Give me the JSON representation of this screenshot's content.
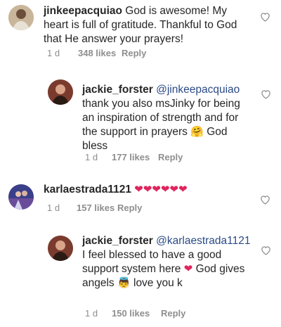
{
  "comments": [
    {
      "username": "jinkeepacquiao",
      "text": " God is awesome! My heart is full of gratitude. Thankful to God that He answer your prayers!",
      "time": "1 d",
      "likes": "348 likes",
      "reply": "Reply",
      "avatar_icon": "avatar-woman-icon"
    },
    {
      "username": "jackie_forster",
      "mention": "@jinkeepacquiao",
      "text": "thank you also msJinky for being an inspiration of strength and for the support in prayers",
      "emoji": "🤗",
      "text_end": " God bless",
      "time": "1 d",
      "likes": "177 likes",
      "reply": "Reply",
      "avatar_icon": "avatar-woman-icon"
    },
    {
      "username": "karlaestrada1121",
      "hearts": "❤❤❤❤❤❤",
      "time": "1 d",
      "likes": "157 likes",
      "reply": "Reply",
      "avatar_icon": "avatar-photo-icon"
    },
    {
      "username": "jackie_forster",
      "mention": "@karlaestrada1121",
      "text": " I feel blessed to have a good support system here",
      "heart": "❤",
      "text_end": " God gives angels",
      "emoji": "👼",
      "text_last": " love you k",
      "time": "1 d",
      "likes": "150 likes",
      "reply": "Reply",
      "avatar_icon": "avatar-woman-icon"
    }
  ],
  "colors": {
    "mention": "#2a4a86",
    "meta": "#8e8e8e",
    "heart_emoji": "#e0245e"
  },
  "icons": {
    "like": "heart-outline-icon"
  }
}
